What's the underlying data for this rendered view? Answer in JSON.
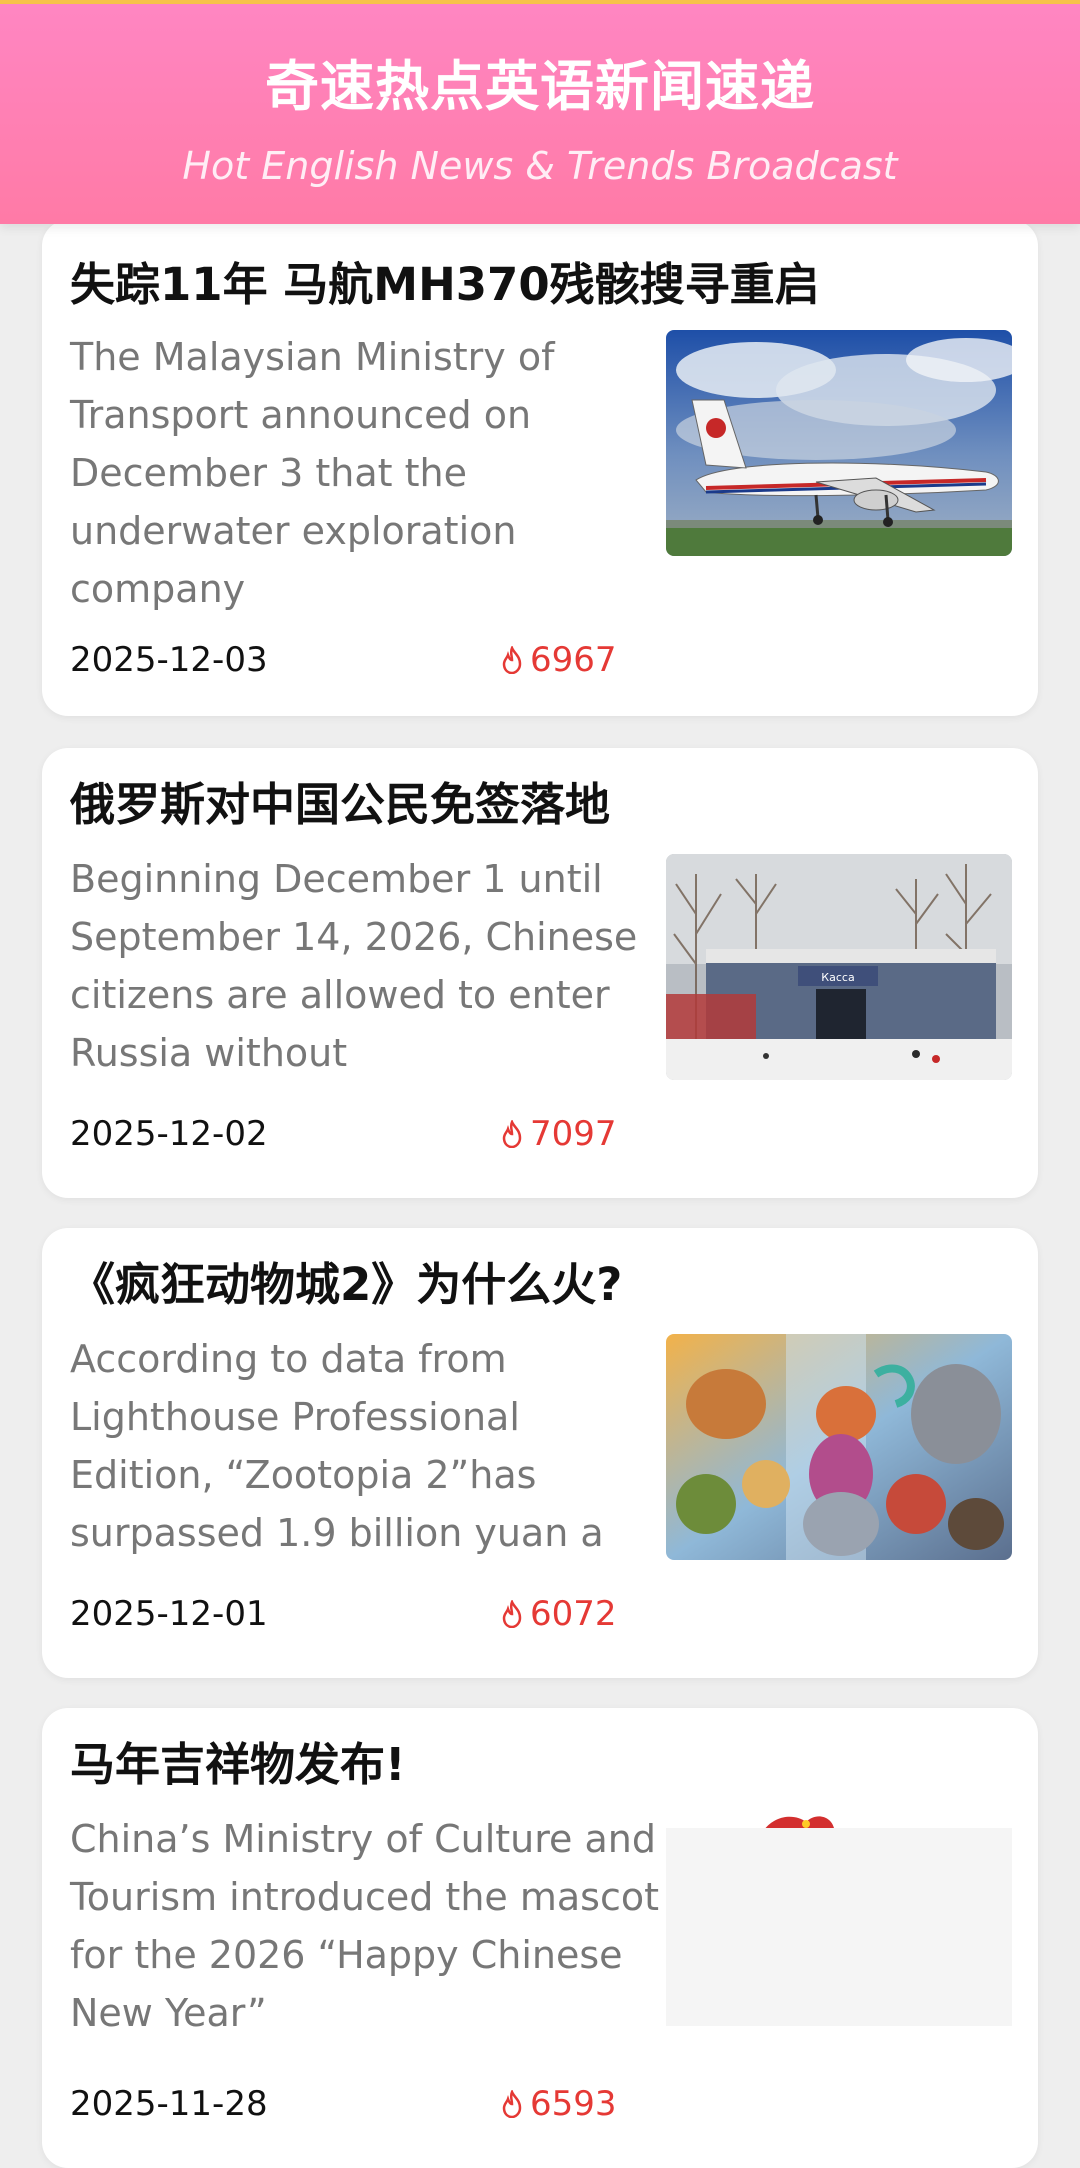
{
  "header": {
    "title": "奇速热点英语新闻速递",
    "subtitle": "Hot English News & Trends Broadcast"
  },
  "colors": {
    "header_pink": "#ff7fb3",
    "hot_red": "#e53935",
    "card_bg": "#ffffff",
    "page_bg": "#eeeeee"
  },
  "news": [
    {
      "title": "失踪11年 马航MH370残骸搜寻重启",
      "summary": "The Malaysian Ministry of Transport announced on December 3 that the underwater exploration company",
      "date": "2025-12-03",
      "hot_count": "6967",
      "icon": "fire-icon"
    },
    {
      "title": "俄罗斯对中国公民免签落地",
      "summary": "Beginning December 1 until September 14, 2026, Chinese citizens are allowed to enter Russia without",
      "date": "2025-12-02",
      "hot_count": "7097",
      "icon": "fire-icon",
      "image_sign": "Касса"
    },
    {
      "title": "《疯狂动物城2》为什么火?",
      "summary": "According to data from Lighthouse Professional Edition, “Zootopia 2”has surpassed 1.9 billion yuan a",
      "date": "2025-12-01",
      "hot_count": "6072",
      "icon": "fire-icon"
    },
    {
      "title": "马年吉祥物发布!",
      "summary": "China’s Ministry of Culture and Tourism introduced the mascot for the 2026 “Happy Chinese New Year”",
      "date": "2025-11-28",
      "hot_count": "6593",
      "icon": "fire-icon"
    }
  ]
}
